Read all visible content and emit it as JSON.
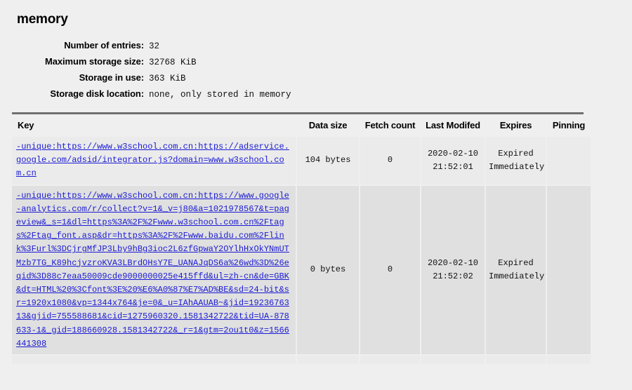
{
  "page": {
    "title": "memory",
    "background_color": "#efefef",
    "link_color": "#1b1bd4"
  },
  "summary": {
    "rows": [
      {
        "label": "Number of entries:",
        "value": "32"
      },
      {
        "label": "Maximum storage size:",
        "value": "32768 KiB"
      },
      {
        "label": "Storage in use:",
        "value": "363 KiB"
      },
      {
        "label": "Storage disk location:",
        "value": "none, only stored in memory"
      }
    ]
  },
  "table": {
    "headers": {
      "key": "Key",
      "data_size": "Data size",
      "fetch_count": "Fetch count",
      "last_modified": "Last Modifed",
      "expires": "Expires",
      "pinning": "Pinning"
    },
    "rows": [
      {
        "key": "-unique:https://www.w3school.com.cn:https://adservice.google.com/adsid/integrator.js?domain=www.w3school.com.cn",
        "data_size": "104 bytes",
        "fetch_count": "0",
        "last_modified_date": "2020-02-10",
        "last_modified_time": "21:52:01",
        "expires_line1": "Expired",
        "expires_line2": "Immediately",
        "pinning": ""
      },
      {
        "key": "-unique:https://www.w3school.com.cn:https://www.google-analytics.com/r/collect?v=1&_v=j80&a=1021978567&t=pageview&_s=1&dl=https%3A%2F%2Fwww.w3school.com.cn%2Ftags%2Ftag_font.asp&dr=https%3A%2F%2Fwww.baidu.com%2Flink%3Furl%3DCjrgMfJP3Lby9hBg3ioc2L6zfGpwaY2OYlhHxOkYNmUTMzb7TG_K89hcjvzroKVA3LBrdOHsY7E_UANAJqDS6a%26wd%3D%26eqid%3D88c7eaa50009cde9000000025e415ffd&ul=zh-cn&de=GBK&dt=HTML%20%3Cfont%3E%20%E6%A0%87%E7%AD%BE&sd=24-bit&sr=1920x1080&vp=1344x764&je=0&_u=IAhAAUAB~&jid=1923676313&gjid=755588681&cid=1275960320.1581342722&tid=UA-878633-1&_gid=188660928.1581342722&_r=1&gtm=2ou1t0&z=1566441308",
        "data_size": "0 bytes",
        "fetch_count": "0",
        "last_modified_date": "2020-02-10",
        "last_modified_time": "21:52:02",
        "expires_line1": "Expired",
        "expires_line2": "Immediately",
        "pinning": ""
      },
      {
        "key": "",
        "data_size": "",
        "fetch_count": "",
        "last_modified_date": "",
        "last_modified_time": "",
        "expires_line1": "",
        "expires_line2": "",
        "pinning": ""
      }
    ]
  }
}
